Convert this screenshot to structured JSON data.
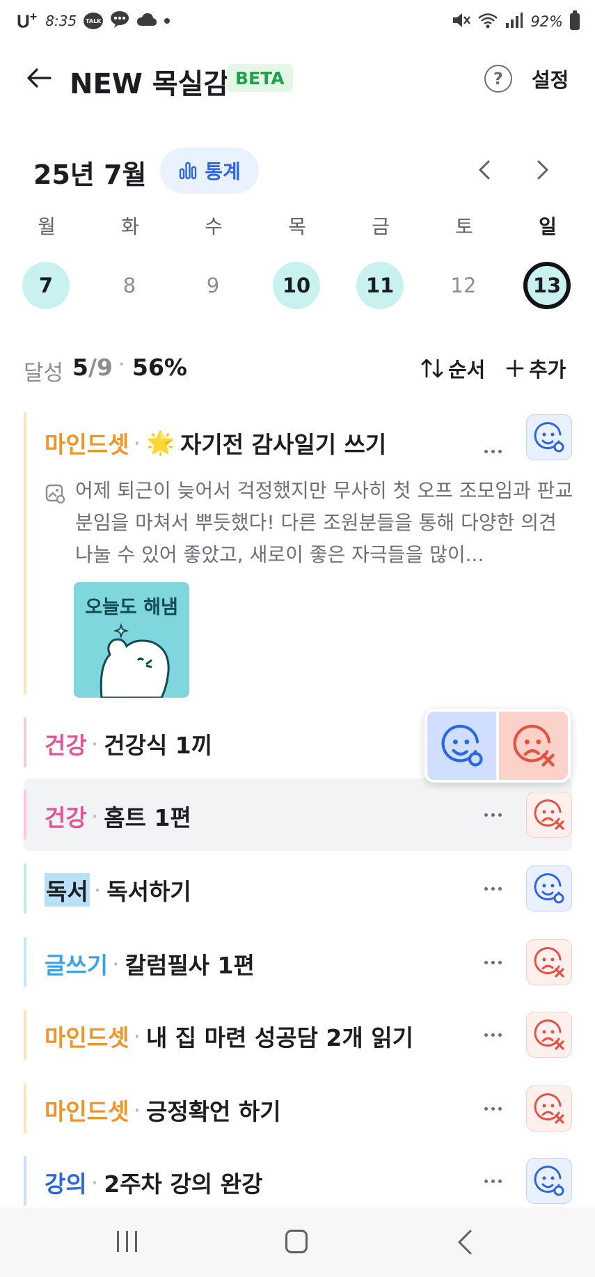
{
  "status_bar": {
    "carrier": "U",
    "carrier_sup": "+",
    "time": "8:35",
    "talk_badge": "TALK",
    "battery": "92%"
  },
  "header": {
    "title": "NEW 목실감",
    "badge": "BETA",
    "help_icon": "question-circle-icon",
    "settings_label": "설정"
  },
  "calendar": {
    "month_label": "25년 7월",
    "stats_label": "통계",
    "days": [
      {
        "weekday": "월",
        "date": "7",
        "state": "done"
      },
      {
        "weekday": "화",
        "date": "8",
        "state": "none"
      },
      {
        "weekday": "수",
        "date": "9",
        "state": "none"
      },
      {
        "weekday": "목",
        "date": "10",
        "state": "done"
      },
      {
        "weekday": "금",
        "date": "11",
        "state": "done"
      },
      {
        "weekday": "토",
        "date": "12",
        "state": "none"
      },
      {
        "weekday": "일",
        "date": "13",
        "state": "today"
      }
    ]
  },
  "summary": {
    "label": "달성",
    "done": "5",
    "total": "/9",
    "dot": "·",
    "percent": "56%",
    "order_label": "순서",
    "add_label": "추가"
  },
  "tasks": [
    {
      "category": "마인드셋",
      "emoji": "🌟",
      "name": "자기전 감사일기 쓰기",
      "status": "success",
      "memo": "어제 퇴근이 늦어서 걱정했지만 무사히 첫 오프 조모임과 판교분임을 마쳐서 뿌듯했다! 다른 조원분들을 통해 다양한 의견 나눌 수 있어 좋았고, 새로이 좋은 자극들을 많이...",
      "sticker_text": "오늘도 해냄"
    },
    {
      "category": "건강",
      "name": "건강식 1끼",
      "status": "popup"
    },
    {
      "category": "건강",
      "name": "홈트 1편",
      "status": "fail"
    },
    {
      "category": "독서",
      "name": "독서하기",
      "status": "success"
    },
    {
      "category": "글쓰기",
      "name": "칼럼필사 1편",
      "status": "fail"
    },
    {
      "category": "마인드셋",
      "name": "내 집 마련 성공담 2개 읽기",
      "status": "fail"
    },
    {
      "category": "마인드셋",
      "name": "긍정확언 하기",
      "status": "fail"
    },
    {
      "category": "강의",
      "name": "2주차 강의 완강",
      "status": "success"
    }
  ],
  "separator": "·",
  "colors": {
    "accent_blue": "#2a66e0",
    "success_bg": "#e9f0ff",
    "fail_bg": "#fff0ee",
    "fail_red": "#e5503f",
    "mindset": "#f09426",
    "health": "#e0559a",
    "writing": "#3ea3e6",
    "done_day": "#c9f1ef",
    "beta_green": "#1fa24a"
  }
}
